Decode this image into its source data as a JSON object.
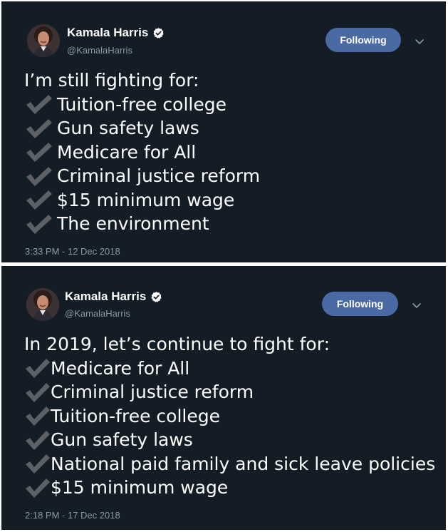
{
  "tweets": [
    {
      "author": {
        "name": "Kamala Harris",
        "handle": "@KamalaHarris",
        "verified_icon": "verified-badge-icon"
      },
      "follow_button_label": "Following",
      "text": {
        "intro": "I’m still fighting for:",
        "items": [
          "Tuition-free college",
          "Gun safety laws",
          "Medicare for All",
          "Criminal justice reform",
          "$15 minimum wage",
          "The environment"
        ],
        "item_icon": "heavy-check-mark-emoji"
      },
      "timestamp": "3:33 PM - 12 Dec 2018"
    },
    {
      "author": {
        "name": "Kamala Harris",
        "handle": "@KamalaHarris",
        "verified_icon": "verified-badge-icon"
      },
      "follow_button_label": "Following",
      "text": {
        "intro": "In 2019, let’s continue to fight for:",
        "items": [
          "Medicare for All",
          "Criminal justice reform",
          "Tuition-free college",
          "Gun safety laws",
          "National paid family and sick leave policies",
          "$15 minimum wage"
        ],
        "item_icon": "heavy-check-mark-emoji"
      },
      "timestamp": "2:18 PM - 17 Dec 2018"
    }
  ],
  "colors": {
    "background": "#141d26",
    "text": "#ffffff",
    "secondary_text": "#8899a6",
    "following_button": "#4a6aa5",
    "check_mark": "#5d6166"
  }
}
